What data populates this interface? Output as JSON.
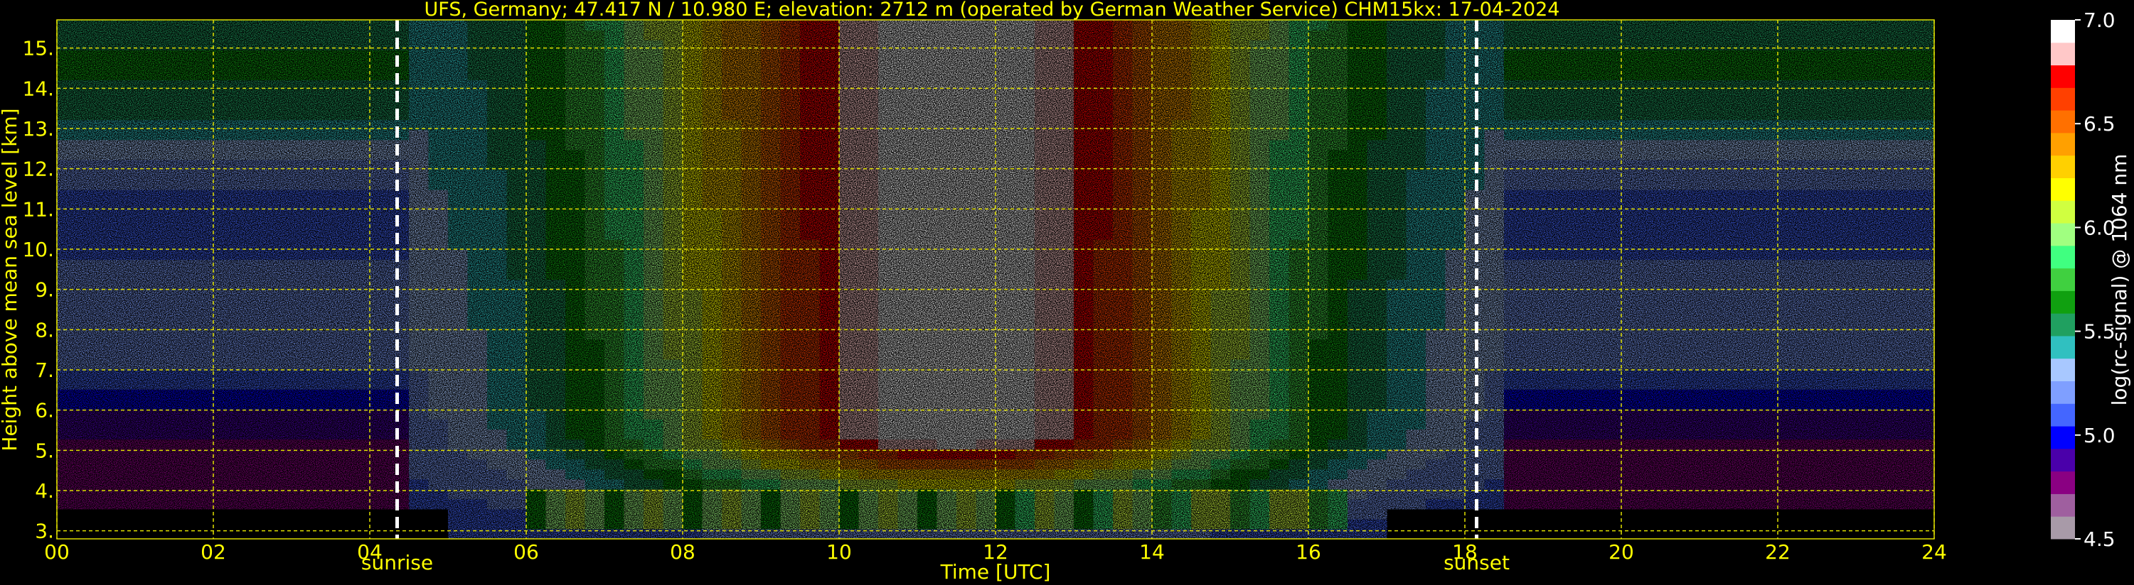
{
  "chart_data": {
    "type": "heatmap",
    "title": "UFS, Germany; 47.417 N / 10.980 E; elevation: 2712 m  (operated by German Weather Service)    CHM15kx: 17-04-2024",
    "xlabel": "Time [UTC]",
    "ylabel": "Height above mean sea level [km]",
    "x_ticks": [
      "00",
      "02",
      "04",
      "06",
      "08",
      "10",
      "12",
      "14",
      "16",
      "18",
      "20",
      "22",
      "24"
    ],
    "x_tick_values": [
      0,
      2,
      4,
      6,
      8,
      10,
      12,
      14,
      16,
      18,
      20,
      22,
      24
    ],
    "y_ticks": [
      "3.",
      "4.",
      "5.",
      "6.",
      "7.",
      "8.",
      "9.",
      "10.",
      "11.",
      "12.",
      "13.",
      "14.",
      "15."
    ],
    "y_tick_values": [
      3,
      4,
      5,
      6,
      7,
      8,
      9,
      10,
      11,
      12,
      13,
      14,
      15
    ],
    "xlim": [
      0,
      24
    ],
    "ylim": [
      2.8,
      15.7
    ],
    "grid": true,
    "events": [
      {
        "label": "sunrise",
        "time": 4.35
      },
      {
        "label": "sunset",
        "time": 18.15
      }
    ],
    "colorbar": {
      "label": "log(rc-signal) @ 1064 nm",
      "range": [
        4.5,
        7.0
      ],
      "ticks": [
        "7.0",
        "6.5",
        "6.0",
        "5.5",
        "5.0",
        "4.5"
      ],
      "tick_values": [
        7.0,
        6.5,
        6.0,
        5.5,
        5.0,
        4.5
      ],
      "colors": [
        "#a89aa8",
        "#9f5f9f",
        "#8a0082",
        "#4a00aa",
        "#0000ff",
        "#4466ff",
        "#7f9fff",
        "#a8c8ff",
        "#30c0c0",
        "#20a060",
        "#10a010",
        "#40d040",
        "#40ff80",
        "#a0ff80",
        "#d0ff40",
        "#ffff00",
        "#ffd000",
        "#ffa000",
        "#ff7000",
        "#ff4000",
        "#ff0000",
        "#ffc8c8",
        "#ffffff"
      ]
    },
    "colors": {
      "text": "#ffff00",
      "grid": "#e0e000",
      "background": "#000000",
      "event_line": "#ffffff"
    }
  }
}
